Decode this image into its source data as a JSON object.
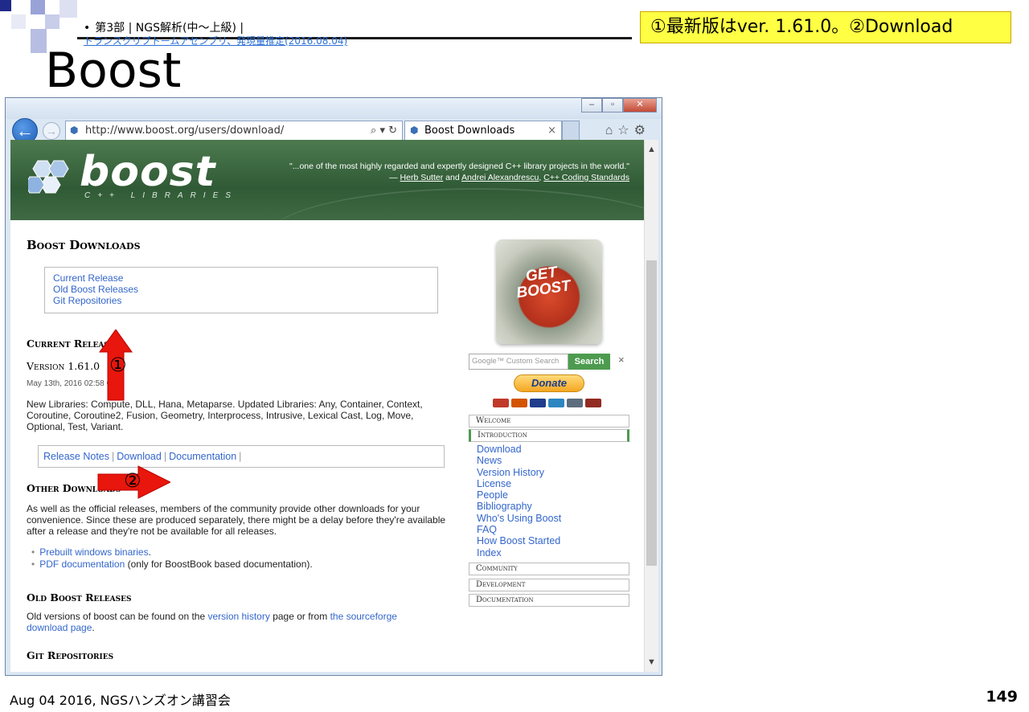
{
  "slide": {
    "breadcrumb": {
      "bullet": "•",
      "section": "第3部 | NGS解析(中〜上級) |",
      "link": "トランスクリプトームアセンブリ、発現量推定(2016.08.04)"
    },
    "note": "①最新版はver. 1.61.0。②Download",
    "title": "Boost",
    "footer": "Aug 04 2016, NGSハンズオン講習会",
    "page_number": "149"
  },
  "browser": {
    "window_buttons": {
      "minimize": "–",
      "restore": "▫",
      "close": "✕"
    },
    "address": "http://www.boost.org/users/download/",
    "address_controls": "⌕ ▾ ↻",
    "tab_title": "Boost Downloads",
    "tab_close": "×",
    "toolbar_icons": "⌂☆⚙"
  },
  "page": {
    "logo": "boost",
    "logo_sub": "C++ LIBRARIES",
    "quote_line1": "\"...one of the most highly regarded and expertly designed C++ library projects in the world.\"",
    "quote_prefix": "— ",
    "quote_author1": "Herb Sutter",
    "quote_and": " and ",
    "quote_author2": "Andrei Alexandrescu",
    "quote_comma": ", ",
    "quote_book": "C++ Coding Standards",
    "heading": "Boost Downloads",
    "toc": [
      "Current Release",
      "Old Boost Releases",
      "Git Repositories"
    ],
    "current_release_heading": "Current Release",
    "version": "Version 1.61.0",
    "date": "May 13th, 2016 02:58 GMT",
    "libraries_text": "New Libraries: Compute, DLL, Hana, Metaparse. Updated Libraries: Any, Container, Context, Coroutine, Coroutine2, Fusion, Geometry, Interprocess, Intrusive, Lexical Cast, Log, Move, Optional, Test, Variant.",
    "release_links": [
      "Release Notes",
      "Download",
      "Documentation"
    ],
    "link_separator": "|",
    "other_downloads_heading": "Other Downloads",
    "other_downloads_text": "As well as the official releases, members of the community provide other downloads for your convenience. Since these are produced separately, there might be a delay before they're available after a release and they're not be available for all releases.",
    "bullet": "•",
    "bullet1_link": "Prebuilt windows binaries",
    "bullet1_rest": ".",
    "bullet2_link": "PDF documentation",
    "bullet2_rest": " (only for BoostBook based documentation).",
    "old_releases_heading": "Old Boost Releases",
    "old_releases_pre": "Old versions of boost can be found on the ",
    "old_releases_link1": "version history",
    "old_releases_mid": " page or from ",
    "old_releases_link2": "the sourceforge download page",
    "old_releases_end": ".",
    "git_heading": "Git Repositories",
    "sidebar": {
      "get_boost_line1": "GET",
      "get_boost_line2": "BOOST",
      "search_placeholder": "Google™ Custom Search",
      "search_button": "Search",
      "search_clear": "×",
      "donate": "Donate",
      "welcome": "Welcome",
      "introduction": "Introduction",
      "intro_links": [
        "Download",
        "News",
        "Version History",
        "License",
        "People",
        "Bibliography",
        "Who's Using Boost",
        "FAQ",
        "How Boost Started",
        "Index"
      ],
      "community": "Community",
      "development": "Development",
      "documentation": "Documentation"
    }
  },
  "annotations": {
    "marker1": "①",
    "marker2": "②",
    "color": "#e8160c"
  },
  "colors": {
    "link": "#3366cc",
    "banner": "#2f5a35",
    "note_bg": "#ffff44"
  }
}
